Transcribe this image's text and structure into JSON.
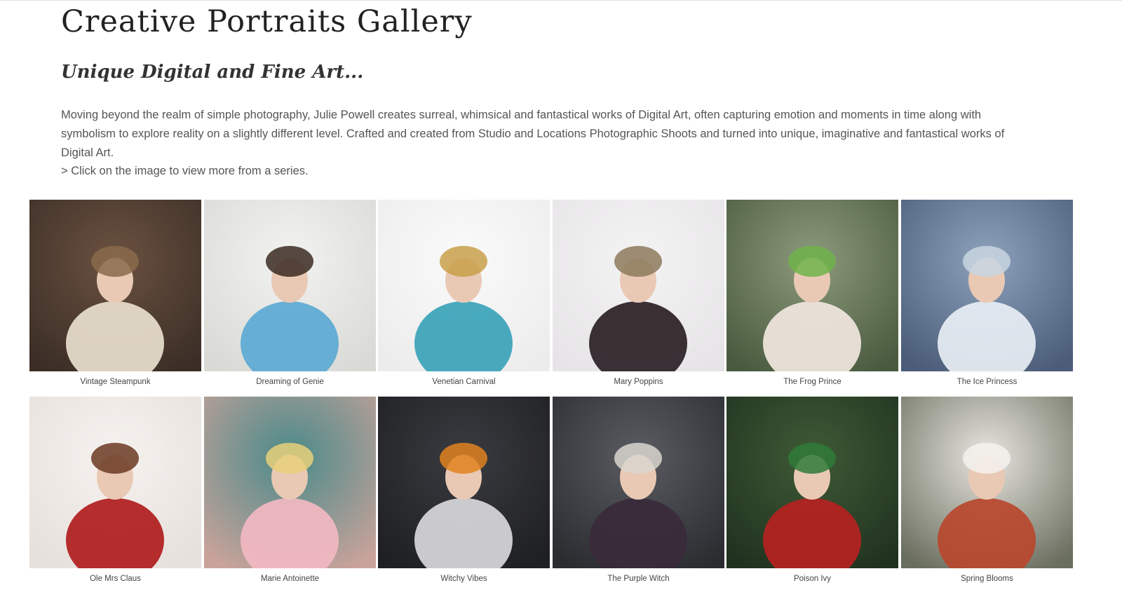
{
  "page": {
    "title": "Creative Portraits Gallery",
    "subtitle": "Unique Digital and Fine Art...",
    "intro": "Moving beyond the realm of simple photography, Julie Powell creates surreal, whimsical and fantastical works of Digital Art, often capturing emotion and moments in time along with symbolism to explore reality on a slightly different level. Crafted and created from Studio and Locations Photographic Shoots and turned into unique, imaginative and fantastical works of Digital Art.",
    "hint": "> Click on the image to view more from a series."
  },
  "gallery": {
    "items": [
      {
        "caption": "Vintage Steampunk",
        "bg": "#3b2e26",
        "bg2": "#6a5140",
        "figure": "#e9dfcf",
        "accent": "#8a6a4a"
      },
      {
        "caption": "Dreaming of Genie",
        "bg": "#d9d9d6",
        "bg2": "#f2f2f0",
        "figure": "#5ba9d2",
        "accent": "#3a2a22"
      },
      {
        "caption": "Venetian Carnival",
        "bg": "#ececec",
        "bg2": "#fafafa",
        "figure": "#3aa3b8",
        "accent": "#c8a04a"
      },
      {
        "caption": "Mary Poppins",
        "bg": "#e6e4e6",
        "bg2": "#f4f3f4",
        "figure": "#2a1f24",
        "accent": "#8c7a5c"
      },
      {
        "caption": "The Frog Prince",
        "bg": "#4a5a3e",
        "bg2": "#8c9a7c",
        "figure": "#f1e7df",
        "accent": "#6fb34a"
      },
      {
        "caption": "The Ice Princess",
        "bg": "#4a5c78",
        "bg2": "#8ea2bc",
        "figure": "#e8eef4",
        "accent": "#c9d6e2"
      },
      {
        "caption": "Ole Mrs Claus",
        "bg": "#e6e0dc",
        "bg2": "#f6f2ef",
        "figure": "#b01c1c",
        "accent": "#6a3a22"
      },
      {
        "caption": "Marie Antoinette",
        "bg": "#c9a39a",
        "bg2": "#4a8a8a",
        "figure": "#f2b9c2",
        "accent": "#e8d07a"
      },
      {
        "caption": "Witchy Vibes",
        "bg": "#1e1f22",
        "bg2": "#3a3b40",
        "figure": "#d8d8dc",
        "accent": "#e0821e"
      },
      {
        "caption": "The Purple Witch",
        "bg": "#2a2c30",
        "bg2": "#5a5c62",
        "figure": "#3a2a3a",
        "accent": "#d9d6cf"
      },
      {
        "caption": "Poison Ivy",
        "bg": "#20321f",
        "bg2": "#3f5a36",
        "figure": "#b52222",
        "accent": "#2f7a3a"
      },
      {
        "caption": "Spring Blooms",
        "bg": "#6a6e5e",
        "bg2": "#e8e6e0",
        "figure": "#b9462e",
        "accent": "#f4f2ee"
      }
    ]
  }
}
